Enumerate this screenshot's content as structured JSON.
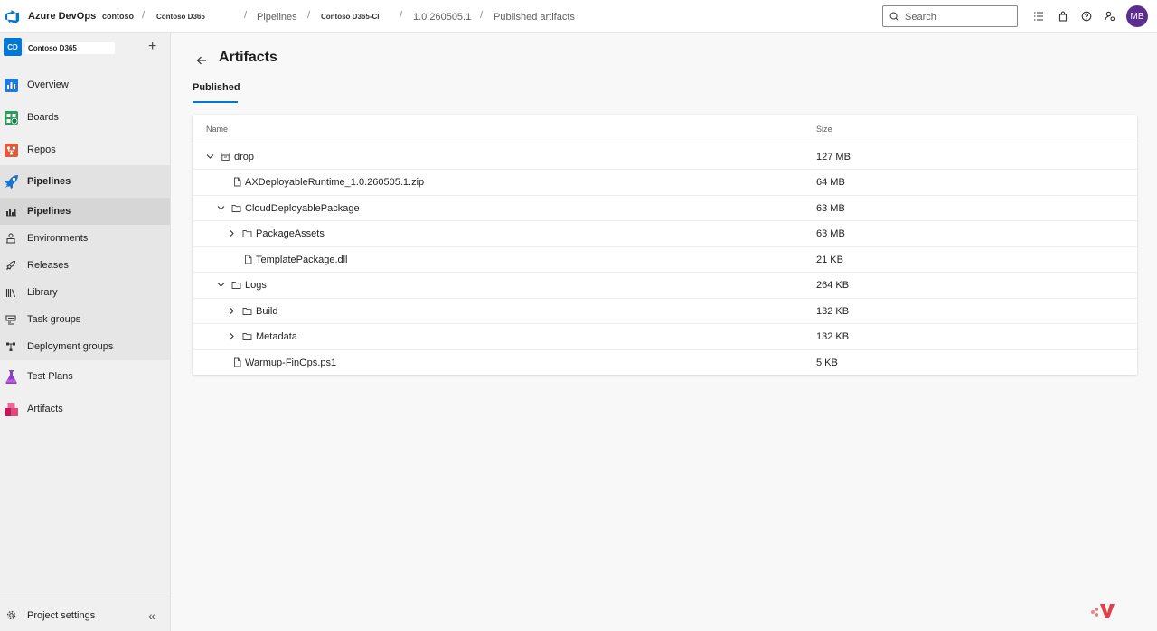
{
  "header": {
    "brand": "Azure DevOps",
    "org": "contoso",
    "breadcrumbs": [
      {
        "label": "Contoso D365"
      },
      {
        "label": "Pipelines"
      },
      {
        "label": "Contoso D365-CI"
      },
      {
        "label": "1.0.260505.1"
      },
      {
        "label": "Published artifacts"
      }
    ],
    "search_placeholder": "Search",
    "icons": [
      "task-list-icon",
      "shopping-bag-icon",
      "help-icon",
      "user-settings-icon"
    ],
    "avatar_initials": "MB"
  },
  "sidebar": {
    "project_badge": "CD",
    "project_name": "Contoso D365",
    "items": [
      {
        "label": "Overview",
        "icon": "overview-icon"
      },
      {
        "label": "Boards",
        "icon": "boards-icon"
      },
      {
        "label": "Repos",
        "icon": "repos-icon"
      },
      {
        "label": "Pipelines",
        "icon": "pipelines-icon"
      },
      {
        "label": "Test Plans",
        "icon": "test-plans-icon"
      },
      {
        "label": "Artifacts",
        "icon": "artifacts-icon"
      }
    ],
    "pipeline_sub_items": [
      {
        "label": "Pipelines"
      },
      {
        "label": "Environments"
      },
      {
        "label": "Releases"
      },
      {
        "label": "Library"
      },
      {
        "label": "Task groups"
      },
      {
        "label": "Deployment groups"
      }
    ],
    "settings_label": "Project settings"
  },
  "main": {
    "title": "Artifacts",
    "tab": "Published",
    "columns": {
      "name": "Name",
      "size": "Size"
    },
    "rows": [
      {
        "name": "drop",
        "size": "127 MB",
        "type": "artifact",
        "expanded": true
      },
      {
        "name": "AXDeployableRuntime_1.0.260505.1.zip",
        "size": "64 MB",
        "type": "file"
      },
      {
        "name": "CloudDeployablePackage",
        "size": "63 MB",
        "type": "folder",
        "expanded": true
      },
      {
        "name": "PackageAssets",
        "size": "63 MB",
        "type": "folder",
        "expanded": false
      },
      {
        "name": "TemplatePackage.dll",
        "size": "21 KB",
        "type": "file"
      },
      {
        "name": "Logs",
        "size": "264 KB",
        "type": "folder",
        "expanded": true
      },
      {
        "name": "Build",
        "size": "132 KB",
        "type": "folder",
        "expanded": false
      },
      {
        "name": "Metadata",
        "size": "132 KB",
        "type": "folder",
        "expanded": false
      },
      {
        "name": "Warmup-FinOps.ps1",
        "size": "5 KB",
        "type": "file"
      }
    ]
  },
  "colors": {
    "accent": "#0078d4",
    "avatar": "#5c2d91"
  }
}
